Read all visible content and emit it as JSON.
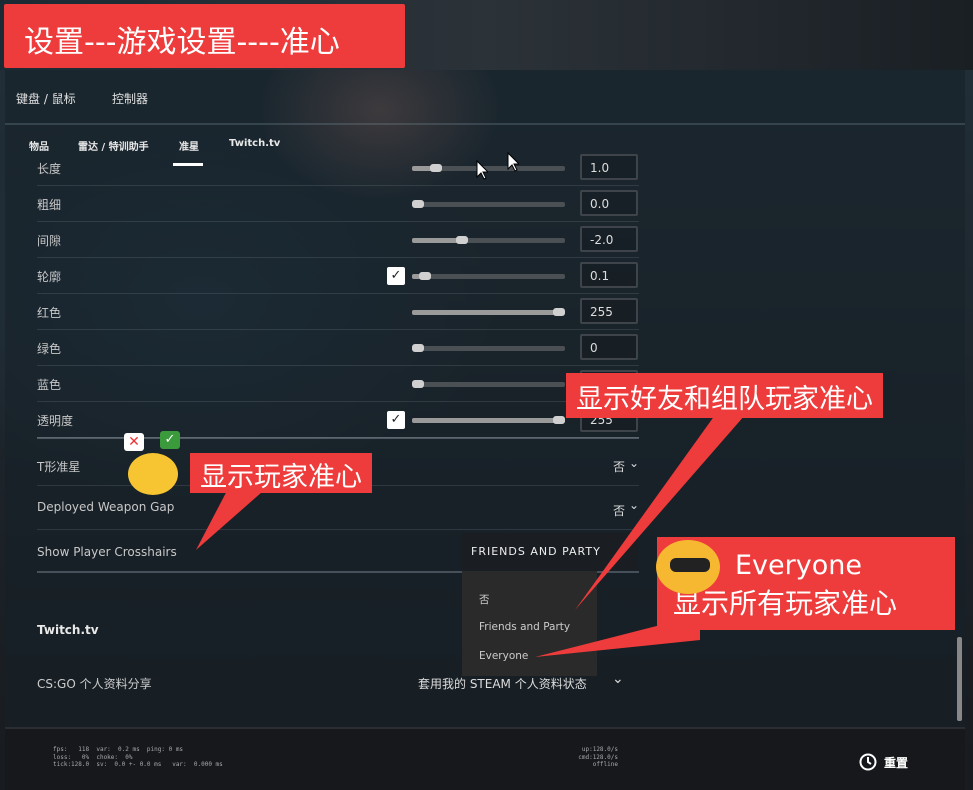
{
  "annotation_title": "设置---游戏设置----准心",
  "header": {
    "tabs": [
      "键盘 / 鼠标",
      "控制器"
    ]
  },
  "subtabs": {
    "items": [
      "物品",
      "雷达 / 特训助手",
      "准星",
      "Twitch.tv"
    ],
    "active": "准星"
  },
  "rows": [
    {
      "label": "长度",
      "value": "1.0",
      "fill": 0.13,
      "checkbox": false
    },
    {
      "label": "粗细",
      "value": "0.0",
      "fill": 0.0,
      "checkbox": false
    },
    {
      "label": "间隙",
      "value": "-2.0",
      "fill": 0.31,
      "checkbox": false
    },
    {
      "label": "轮廓",
      "value": "0.1",
      "fill": 0.05,
      "checkbox": true
    },
    {
      "label": "红色",
      "value": "255",
      "fill": 1.0,
      "checkbox": false
    },
    {
      "label": "绿色",
      "value": "0",
      "fill": 0.0,
      "checkbox": false
    },
    {
      "label": "蓝色",
      "value": "0",
      "fill": 0.0,
      "checkbox": false
    },
    {
      "label": "透明度",
      "value": "255",
      "fill": 1.0,
      "checkbox": true
    }
  ],
  "dropdowns": {
    "t_style": {
      "label": "T形准星",
      "value": "否"
    },
    "deployed_gap": {
      "label": "Deployed Weapon Gap",
      "value": "否"
    },
    "show_player": {
      "label": "Show Player Crosshairs",
      "value": "FRIENDS AND PARTY",
      "options": [
        "否",
        "Friends and Party",
        "Everyone"
      ]
    }
  },
  "twitch_section": "Twitch.tv",
  "profile": {
    "label": "CS:GO 个人资料分享",
    "value": "套用我的 STEAM 个人资料状态"
  },
  "footer": {
    "stats_left": [
      "fps:   118  var:  0.2 ms  ping: 0 ms",
      "loss:   0%  choke:  0%",
      "tick:128.0  sv:  0.0 +- 0.0 ms   var:  0.000 ms"
    ],
    "stats_right": [
      "up:128.0/s",
      "cmd:128.0/s",
      "offline"
    ],
    "reset_label": "重置"
  },
  "callouts": {
    "show_player": "显示玩家准心",
    "friends_party": "显示好友和组队玩家准心",
    "everyone_en": "Everyone",
    "everyone_cn": "显示所有玩家准心"
  },
  "colors": {
    "callout": "#ee3b3b",
    "checkbox": "#ffffff"
  }
}
